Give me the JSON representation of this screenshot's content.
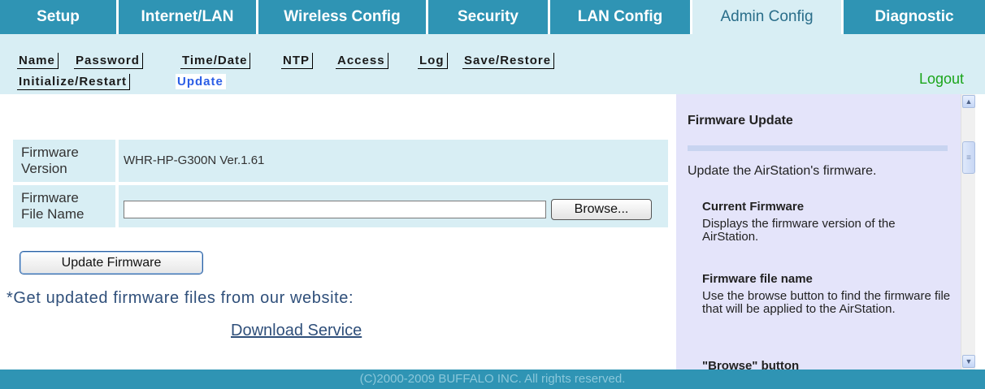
{
  "top_tabs": [
    {
      "label": "Setup"
    },
    {
      "label": "Internet/LAN"
    },
    {
      "label": "Wireless Config"
    },
    {
      "label": "Security"
    },
    {
      "label": "LAN Config"
    },
    {
      "label": "Admin Config"
    },
    {
      "label": "Diagnostic"
    }
  ],
  "active_tab": "Admin Config",
  "sub_tabs": [
    {
      "label": "Name"
    },
    {
      "label": "Password"
    },
    {
      "label": "Time/Date"
    },
    {
      "label": "NTP"
    },
    {
      "label": "Access"
    },
    {
      "label": "Log"
    },
    {
      "label": "Save/Restore"
    },
    {
      "label": "Initialize/Restart"
    },
    {
      "label": "Update"
    }
  ],
  "current_sub_tab": "Update",
  "logout_label": "Logout",
  "form": {
    "version_label_line1": "Firmware",
    "version_label_line2": "Version",
    "version_value": "WHR-HP-G300N Ver.1.61",
    "file_label_line1": "Firmware",
    "file_label_line2": "File Name",
    "file_value": "",
    "browse_label": "Browse...",
    "update_button": "Update Firmware",
    "note": "*Get updated firmware files from our website:",
    "download_link": "Download Service"
  },
  "help": {
    "title": "Firmware Update",
    "intro": "Update the AirStation's firmware.",
    "sections": [
      {
        "heading": "Current Firmware",
        "text": "Displays the firmware version of the AirStation."
      },
      {
        "heading": "Firmware file name",
        "text": "Use the browse button to find the firmware file that will be applied to the AirStation."
      },
      {
        "heading": "\"Browse\" button",
        "text": ""
      }
    ]
  },
  "footer_text": "(C)2000-2009 BUFFALO INC. All rights reserved.",
  "colors": {
    "tab_bg": "#2f94b4",
    "subnav_bg": "#d8eef4",
    "help_bg": "#e4e4fa",
    "logout": "#1aa51a",
    "link": "#2f4f7a"
  }
}
